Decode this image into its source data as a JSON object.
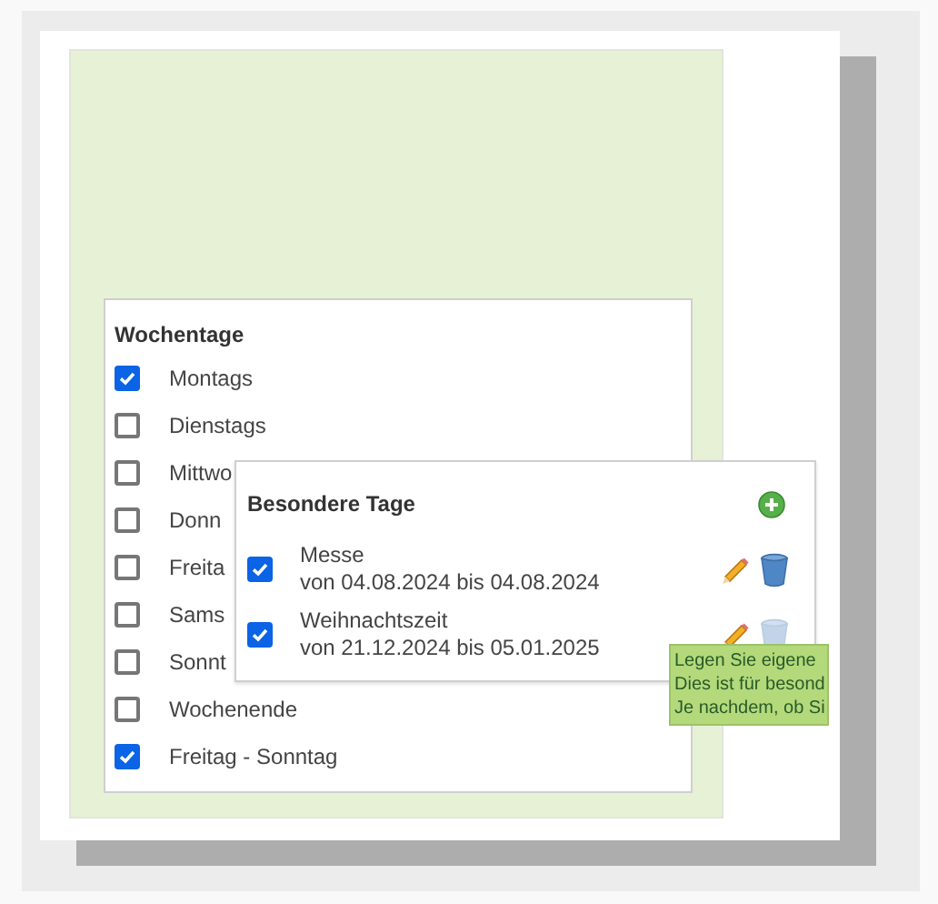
{
  "weekdays": {
    "title": "Wochentage",
    "items": [
      {
        "label": "Montags",
        "checked": true
      },
      {
        "label": "Dienstags",
        "checked": false
      },
      {
        "label": "Mittwo",
        "checked": false
      },
      {
        "label": "Donn",
        "checked": false
      },
      {
        "label": "Freita",
        "checked": false
      },
      {
        "label": "Sams",
        "checked": false
      },
      {
        "label": "Sonnt",
        "checked": false
      },
      {
        "label": "Wochenende",
        "checked": false
      },
      {
        "label": "Freitag - Sonntag",
        "checked": true
      }
    ]
  },
  "special_days": {
    "title": "Besondere Tage",
    "items": [
      {
        "name": "Messe",
        "range": "von 04.08.2024 bis 04.08.2024",
        "checked": true,
        "delete_disabled": false
      },
      {
        "name": "Weihnachtszeit",
        "range": "von 21.12.2024 bis 05.01.2025",
        "checked": true,
        "delete_disabled": true
      }
    ]
  },
  "tooltip": {
    "lines": [
      "Legen Sie eigene",
      "Dies ist für besond",
      "Je nachdem, ob Si"
    ]
  }
}
